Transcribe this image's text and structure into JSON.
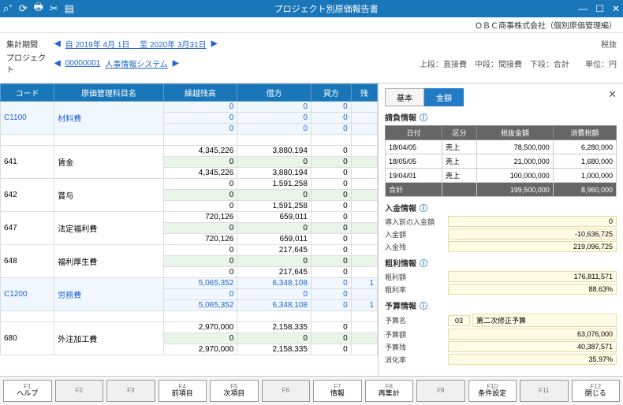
{
  "titlebar": {
    "title": "プロジェクト別原価報告書"
  },
  "subtitle": "ＯＢＣ商事株式会社（個別原価管理編）",
  "criteria": {
    "period_label": "集計期間",
    "period_text": "自 2019年 4月 1日 　至 2020年 3月31日",
    "project_label": "プロジェクト",
    "project_code": "00000001",
    "project_name": "人事情報システム",
    "tax_note": "税抜",
    "stage_note": "上段：直接費　中段：間接費　下段：合計　　単位：円"
  },
  "grid": {
    "headers": [
      "コード",
      "原価管理科目名",
      "繰越残高",
      "借方",
      "貸方",
      "残"
    ],
    "rows": [
      {
        "code": "C1100",
        "name": "材料費",
        "hi": true,
        "v": [
          [
            "0",
            "0",
            "0",
            ""
          ],
          [
            "0",
            "0",
            "0",
            ""
          ],
          [
            "0",
            "0",
            "0",
            ""
          ]
        ]
      },
      {
        "code": "",
        "name": "",
        "v": [
          [
            "",
            "",
            "",
            ""
          ]
        ]
      },
      {
        "code": "641",
        "name": "賃金",
        "v": [
          [
            "4,345,226",
            "3,880,194",
            "0",
            ""
          ],
          [
            "0",
            "0",
            "0",
            ""
          ],
          [
            "4,345,226",
            "3,880,194",
            "0",
            ""
          ]
        ]
      },
      {
        "code": "642",
        "name": "賞与",
        "v": [
          [
            "0",
            "1,591,258",
            "0",
            ""
          ],
          [
            "0",
            "0",
            "0",
            ""
          ],
          [
            "0",
            "1,591,258",
            "0",
            ""
          ]
        ]
      },
      {
        "code": "647",
        "name": "法定福利費",
        "v": [
          [
            "720,126",
            "659,011",
            "0",
            ""
          ],
          [
            "0",
            "0",
            "0",
            ""
          ],
          [
            "720,126",
            "659,011",
            "0",
            ""
          ]
        ]
      },
      {
        "code": "648",
        "name": "福利厚生費",
        "v": [
          [
            "0",
            "217,645",
            "0",
            ""
          ],
          [
            "0",
            "0",
            "0",
            ""
          ],
          [
            "0",
            "217,645",
            "0",
            ""
          ]
        ]
      },
      {
        "code": "C1200",
        "name": "労務費",
        "hi": true,
        "v": [
          [
            "5,065,352",
            "6,348,108",
            "0",
            "1"
          ],
          [
            "0",
            "0",
            "0",
            ""
          ],
          [
            "5,065,352",
            "6,348,108",
            "0",
            "1"
          ]
        ]
      },
      {
        "code": "",
        "name": "",
        "v": [
          [
            "",
            "",
            "",
            ""
          ]
        ]
      },
      {
        "code": "680",
        "name": "外注加工費",
        "v": [
          [
            "2,970,000",
            "2,158,335",
            "0",
            ""
          ],
          [
            "0",
            "0",
            "0",
            ""
          ],
          [
            "2,970,000",
            "2,158,335",
            "0",
            ""
          ]
        ]
      }
    ]
  },
  "detail": {
    "tabs": {
      "basic": "基本",
      "amount": "金額"
    },
    "contract": {
      "title": "請負情報",
      "headers": [
        "日付",
        "区分",
        "税抜金額",
        "消費税額"
      ],
      "rows": [
        [
          "18/04/05",
          "売上",
          "78,500,000",
          "6,280,000"
        ],
        [
          "18/05/05",
          "売上",
          "21,000,000",
          "1,680,000"
        ],
        [
          "19/04/01",
          "売上",
          "100,000,000",
          "1,000,000"
        ]
      ],
      "total": [
        "合計",
        "",
        "199,500,000",
        "8,960,000"
      ]
    },
    "receipt": {
      "title": "入金情報",
      "items": [
        {
          "k": "導入前の入金額",
          "v": "0"
        },
        {
          "k": "入金額",
          "v": "-10,636,725"
        },
        {
          "k": "入金残",
          "v": "219,096,725"
        }
      ]
    },
    "profit": {
      "title": "粗利情報",
      "items": [
        {
          "k": "粗利額",
          "v": "176,811,571"
        },
        {
          "k": "粗利率",
          "v": "88.63%"
        }
      ]
    },
    "budget": {
      "title": "予算情報",
      "name_label": "予算名",
      "name_code": "03",
      "name_text": "第二次修正予算",
      "items": [
        {
          "k": "予算額",
          "v": "63,076,000"
        },
        {
          "k": "予算残",
          "v": "40,387,571"
        },
        {
          "k": "消化率",
          "v": "35.97%"
        }
      ]
    }
  },
  "fkeys": [
    {
      "fn": "F1",
      "label": "ヘルプ",
      "en": true
    },
    {
      "fn": "F2",
      "label": "",
      "en": false
    },
    {
      "fn": "F3",
      "label": "",
      "en": false
    },
    {
      "fn": "F4",
      "label": "前項目",
      "en": true
    },
    {
      "fn": "F5",
      "label": "次項目",
      "en": true
    },
    {
      "fn": "F6",
      "label": "",
      "en": false
    },
    {
      "fn": "F7",
      "label": "情報",
      "en": true
    },
    {
      "fn": "F8",
      "label": "再集計",
      "en": true
    },
    {
      "fn": "F9",
      "label": "",
      "en": false
    },
    {
      "fn": "F10",
      "label": "条件設定",
      "en": true
    },
    {
      "fn": "F11",
      "label": "",
      "en": false
    },
    {
      "fn": "F12",
      "label": "閉じる",
      "en": true
    }
  ]
}
